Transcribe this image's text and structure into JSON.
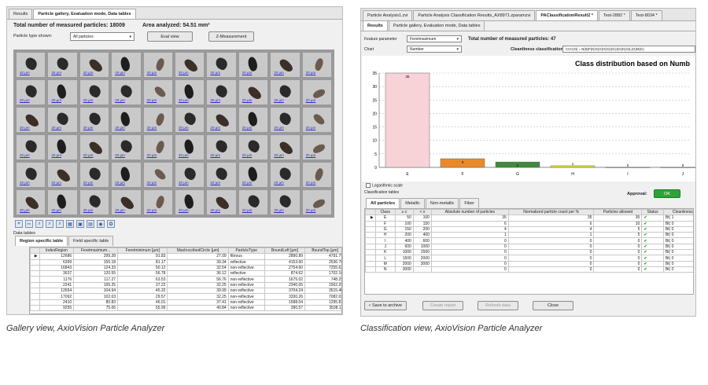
{
  "left": {
    "tabs": [
      "Results",
      "Particle gallery, Evaluation mode, Data tables"
    ],
    "total_label": "Total number of measured particles: 18009",
    "area_label": "Area analyzed: 54.51 mm²",
    "type_label": "Particle type shown:",
    "type_value": "All particles",
    "eval_button": "Eval view",
    "zmeasure_button": "Z-Measurement",
    "scale_label": "20 µm",
    "tools": [
      "⌖",
      "✂",
      "⌕",
      "⌕",
      "⌕",
      "▦",
      "▣",
      "▤",
      "◉",
      "✪"
    ],
    "data_tables_label": "Data tables",
    "subtabs": [
      "Region specific table",
      "Field specific table"
    ],
    "columns": [
      "",
      "IndexRegion",
      "Feretmaximum...",
      "Feretminimum [µm]",
      "MaxInscribedCircle [µm]",
      "ParticleType",
      "BoundLeft [µm]",
      "BoundTop [µm]",
      "Bounds"
    ],
    "rows": [
      [
        "12686",
        "299.28",
        "91.83",
        "27.09",
        "fibrous",
        "2890.89",
        "4791.79",
        ""
      ],
      [
        "6399",
        "155.18",
        "81.17",
        "39.34",
        "reflective",
        "4153.60",
        "2536.78",
        ""
      ],
      [
        "16843",
        "124.33",
        "50.12",
        "32.54",
        "non-reflective",
        "2754.60",
        "7255.63",
        ""
      ],
      [
        "3637",
        "120.55",
        "56.78",
        "36.12",
        "reflective",
        "874.62",
        "1702.16",
        ""
      ],
      [
        "1176",
        "117.27",
        "63.53",
        "56.76",
        "non-reflective",
        "1675.02",
        "748.29",
        ""
      ],
      [
        "2241",
        "105.25",
        "37.22",
        "32.25",
        "non-reflective",
        "2340.05",
        "1502.29",
        ""
      ],
      [
        "12654",
        "104.94",
        "45.32",
        "39.99",
        "non-reflective",
        "3704.24",
        "3515.40",
        ""
      ],
      [
        "17092",
        "102.03",
        "29.57",
        "32.25",
        "non-reflective",
        "3330.26",
        "7082.03",
        ""
      ],
      [
        "2410",
        "80.83",
        "46.01",
        "37.41",
        "non-reflective",
        "1588.04",
        "1295.81",
        ""
      ],
      [
        "9255",
        "75.06",
        "55.99",
        "40.84",
        "non-reflective",
        "280.57",
        "3538.11",
        ""
      ]
    ]
  },
  "right": {
    "tabs": [
      "Particle Analysis1.zvi",
      "Particle Analysis Classification Results_AX8971.zparamzvi",
      "PAClassificationResult2 *",
      "Test-2882 *",
      "Test-8034 *"
    ],
    "subtabs": [
      "Results",
      "Particle gallery, Evaluation mode, Data tables"
    ],
    "feature_label": "Feature parameter",
    "feature_value": "Feretmaximum",
    "chart_label": "Chart",
    "chart_value": "Number",
    "total_label": "Total number of measured particles: 47",
    "cleanliness_label": "Cleanliness classification:",
    "cleanliness_value": "CCC(N) = N(B)F(D)G(G)H(G)I(G)J(G)K(G)L(G)M(G)",
    "log_scale": "Logarithmic scale",
    "classification_tables": "Classification tables",
    "approval_label": "Approval:",
    "approval_value": "OK",
    "class_tabs": [
      "All particles",
      "Metallic",
      "Non-metallic",
      "Fiber"
    ],
    "table_columns": [
      "Class",
      "≥ x",
      "< x",
      "Absolute number of particles",
      "Normalized particle count per %",
      "Particles allowed",
      "Status",
      "Cleanliness Le..."
    ],
    "table_rows": [
      [
        "E",
        "50",
        "100",
        "35",
        "35",
        "35",
        "",
        "Bt( 1"
      ],
      [
        "F",
        "100",
        "150",
        "6",
        "6",
        "10",
        "",
        "Bt( 0"
      ],
      [
        "G",
        "150",
        "200",
        "4",
        "4",
        "5",
        "",
        "Bt( 0"
      ],
      [
        "H",
        "200",
        "400",
        "1",
        "1",
        "5",
        "",
        "Bt( 0"
      ],
      [
        "I",
        "400",
        "600",
        "0",
        "0",
        "0",
        "",
        "Bt( 0"
      ],
      [
        "J",
        "600",
        "1000",
        "0",
        "0",
        "0",
        "",
        "Bt( 0"
      ],
      [
        "K",
        "1000",
        "1500",
        "0",
        "0",
        "0",
        "",
        "Bt( 0"
      ],
      [
        "L",
        "1500",
        "2000",
        "0",
        "0",
        "0",
        "",
        "Bt( 0"
      ],
      [
        "M",
        "2000",
        "3000",
        "0",
        "0",
        "0",
        "",
        "Bt( 0"
      ],
      [
        "N",
        "3000",
        "",
        "0",
        "0",
        "0",
        "",
        "Bt( 0"
      ]
    ],
    "save_button": "Save to archive",
    "create_report_button": "Create report",
    "refresh_button": "Refresh data",
    "close_button": "Close"
  },
  "captions": {
    "left": "Gallery view, AxioVision Particle Analyzer",
    "right": "Classification view, AxioVision Particle Analyzer"
  },
  "chart_data": {
    "type": "bar",
    "title": "Class distribution based on Numb",
    "categories": [
      "E",
      "F",
      "G",
      "H",
      "I",
      "J"
    ],
    "values": [
      35,
      3.2,
      2,
      0.6,
      0.05,
      0.05
    ],
    "ylim": [
      0,
      35
    ],
    "yticks": [
      0,
      5,
      10,
      15,
      20,
      25,
      30,
      35
    ],
    "grid": true,
    "colors": [
      "#f7d3d8",
      "#e98a2a",
      "#3f8a3e",
      "#e8e03a",
      "#cccccc",
      "#cccccc"
    ],
    "data_labels": [
      "35",
      "3",
      "2",
      "1",
      "0",
      "0"
    ]
  }
}
